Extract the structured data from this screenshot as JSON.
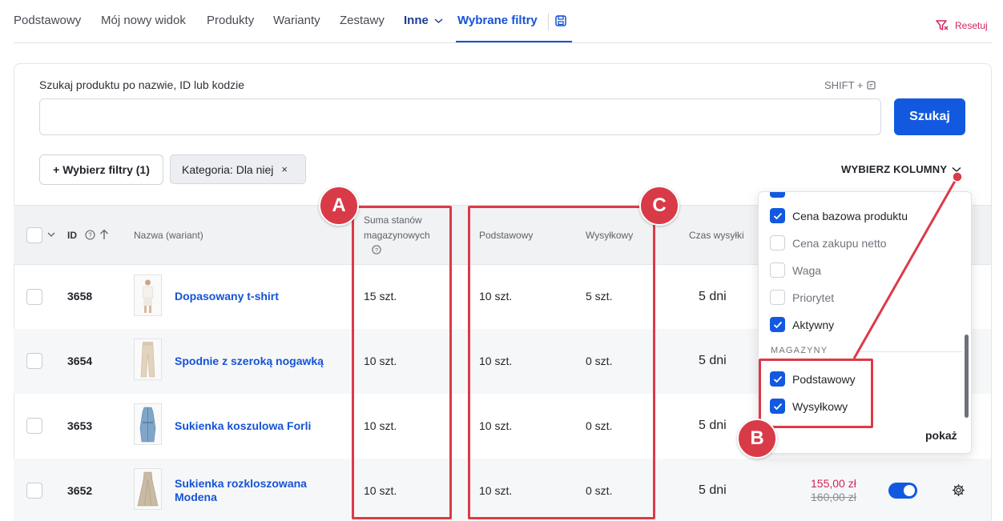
{
  "tabs": [
    {
      "label": "Podstawowy"
    },
    {
      "label": "Mój nowy widok"
    },
    {
      "label": "Produkty"
    },
    {
      "label": "Warianty"
    },
    {
      "label": "Zestawy"
    },
    {
      "label": "Inne"
    },
    {
      "label": "Wybrane filtry"
    }
  ],
  "reset_label": "Resetuj",
  "search": {
    "label": "Szukaj produktu po nazwie, ID lub kodzie",
    "shortcut": "SHIFT +",
    "value": "",
    "button": "Szukaj"
  },
  "filters": {
    "choose_label": "+ Wybierz filtry (1)",
    "chip_label": "Kategoria: Dla niej",
    "chip_remove": "×"
  },
  "columns_button": "WYBIERZ KOLUMNY",
  "table": {
    "headers": {
      "id": "ID",
      "name": "Nazwa (wariant)",
      "stock_sum_line1": "Suma stanów",
      "stock_sum_line2": "magazynowych",
      "wh_basic": "Podstawowy",
      "wh_shipping": "Wysyłkowy",
      "ship_time": "Czas wysyłki"
    },
    "rows": [
      {
        "id": "3658",
        "name": "Dopasowany t-shirt",
        "stock_sum": "15 szt.",
        "wh_basic": "10 szt.",
        "wh_shipping": "5 szt.",
        "ship_time": "5 dni"
      },
      {
        "id": "3654",
        "name": "Spodnie z szeroką nogawką",
        "stock_sum": "10 szt.",
        "wh_basic": "10 szt.",
        "wh_shipping": "0 szt.",
        "ship_time": "5 dni"
      },
      {
        "id": "3653",
        "name": "Sukienka koszulowa Forli",
        "stock_sum": "10 szt.",
        "wh_basic": "10 szt.",
        "wh_shipping": "0 szt.",
        "ship_time": "5 dni"
      },
      {
        "id": "3652",
        "name_line1": "Sukienka rozkloszowana",
        "name_line2": "Modena",
        "stock_sum": "10 szt.",
        "wh_basic": "10 szt.",
        "wh_shipping": "0 szt.",
        "ship_time": "5 dni",
        "price": "155,00 zł",
        "old_price": "160,00 zł"
      }
    ]
  },
  "column_picker": {
    "items": [
      {
        "label": "Cena bazowa produktu",
        "checked": true
      },
      {
        "label": "Cena zakupu netto",
        "checked": false
      },
      {
        "label": "Waga",
        "checked": false
      },
      {
        "label": "Priorytet",
        "checked": false
      },
      {
        "label": "Aktywny",
        "checked": true
      }
    ],
    "section_label": "MAGAZYNY",
    "warehouses": [
      {
        "label": "Podstawowy",
        "checked": true
      },
      {
        "label": "Wysyłkowy",
        "checked": true
      }
    ],
    "show_label": "pokaż"
  },
  "annotations": {
    "a": "A",
    "b": "B",
    "c": "C",
    "color": "#dc3a47"
  },
  "colors": {
    "accent": "#1259e0",
    "link": "#1553d6",
    "price": "#d3245a"
  }
}
